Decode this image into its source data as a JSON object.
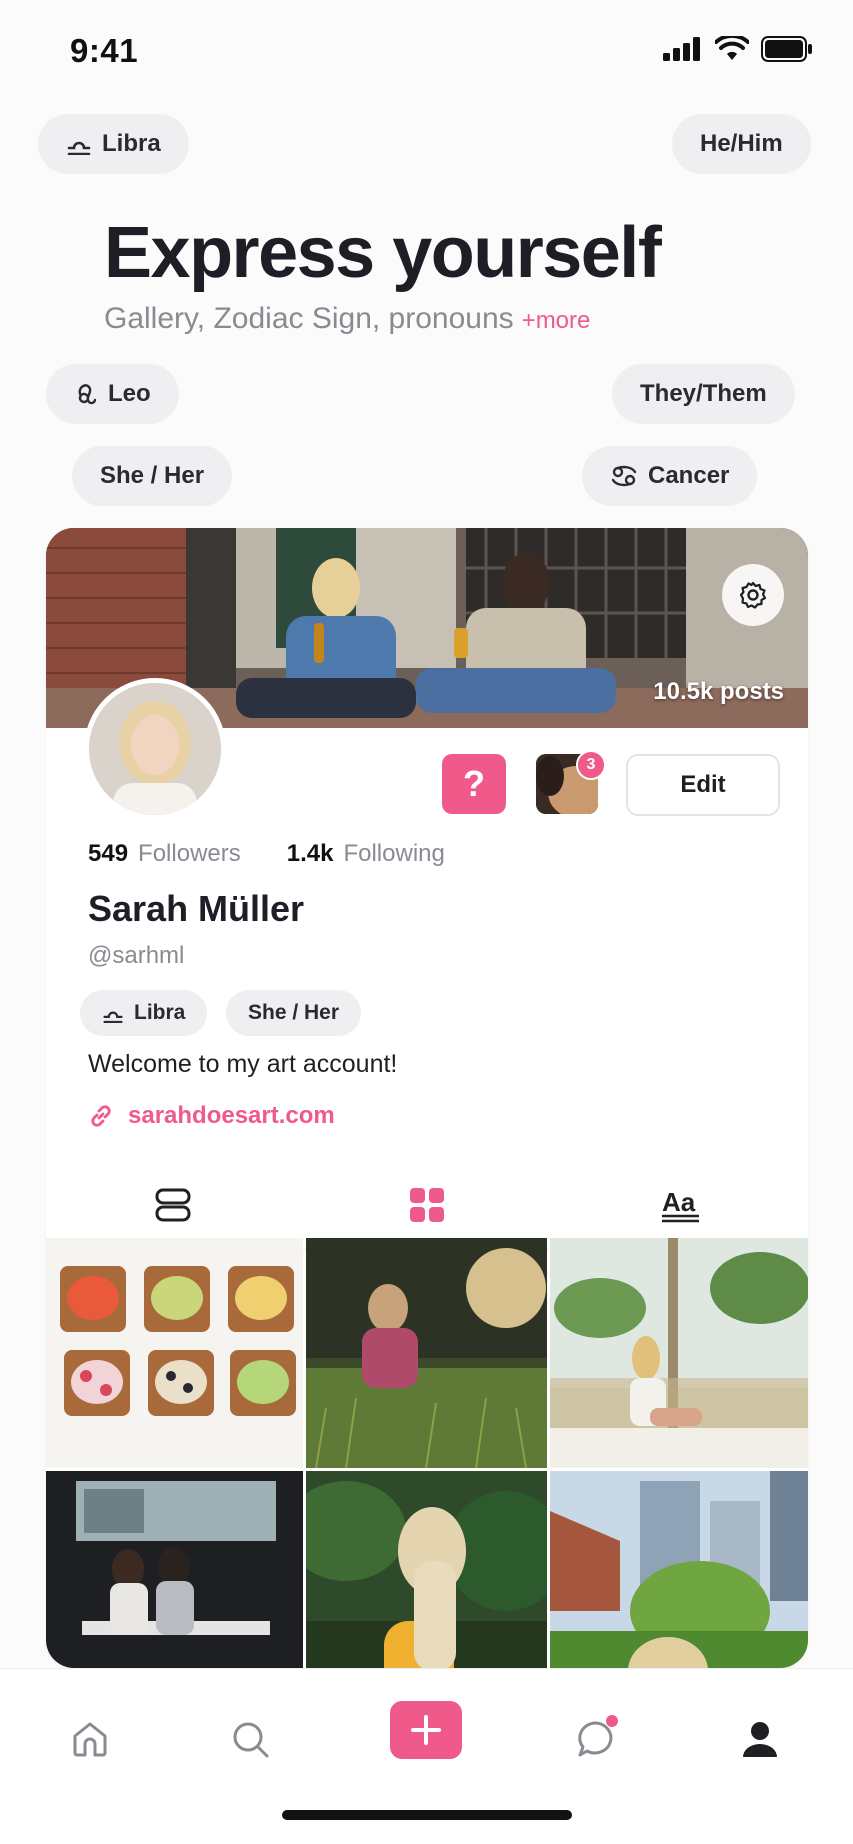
{
  "status_bar": {
    "time": "9:41"
  },
  "hero": {
    "title": "Express yourself",
    "subtitle": "Gallery, Zodiac Sign, pronouns",
    "more": "+more"
  },
  "floating_chips": {
    "libra": "Libra",
    "he_him": "He/Him",
    "leo": "Leo",
    "they_them": "They/Them",
    "she_her": "She / Her",
    "cancer": "Cancer"
  },
  "profile": {
    "posts": "10.5k posts",
    "question_label": "?",
    "story_badge": "3",
    "edit_label": "Edit",
    "followers_count": "549",
    "followers_label": "Followers",
    "following_count": "1.4k",
    "following_label": "Following",
    "name": "Sarah Müller",
    "handle": "@sarhml",
    "tags": [
      "Libra",
      "She / Her"
    ],
    "bio": "Welcome to my art account!",
    "link": "sarahdoesart.com"
  },
  "tabs": [
    {
      "icon": "list-view-icon",
      "active": false
    },
    {
      "icon": "grid-view-icon",
      "active": true
    },
    {
      "icon": "text-view-icon",
      "active": false
    }
  ],
  "gallery": [
    {
      "name": "toast-photo"
    },
    {
      "name": "meadow-sunset-photo"
    },
    {
      "name": "window-palms-photo"
    },
    {
      "name": "gallery-visitors-photo"
    },
    {
      "name": "forest-lake-photo"
    },
    {
      "name": "city-park-photo"
    }
  ],
  "bottom_nav": [
    {
      "icon": "home-icon"
    },
    {
      "icon": "search-icon"
    },
    {
      "icon": "add-icon"
    },
    {
      "icon": "chat-icon",
      "has_notification": true
    },
    {
      "icon": "profile-icon",
      "active": true
    }
  ],
  "colors": {
    "accent": "#ef5a8b",
    "chip_bg": "#efeff1",
    "text": "#1e1f26",
    "muted": "#8a8a92"
  }
}
